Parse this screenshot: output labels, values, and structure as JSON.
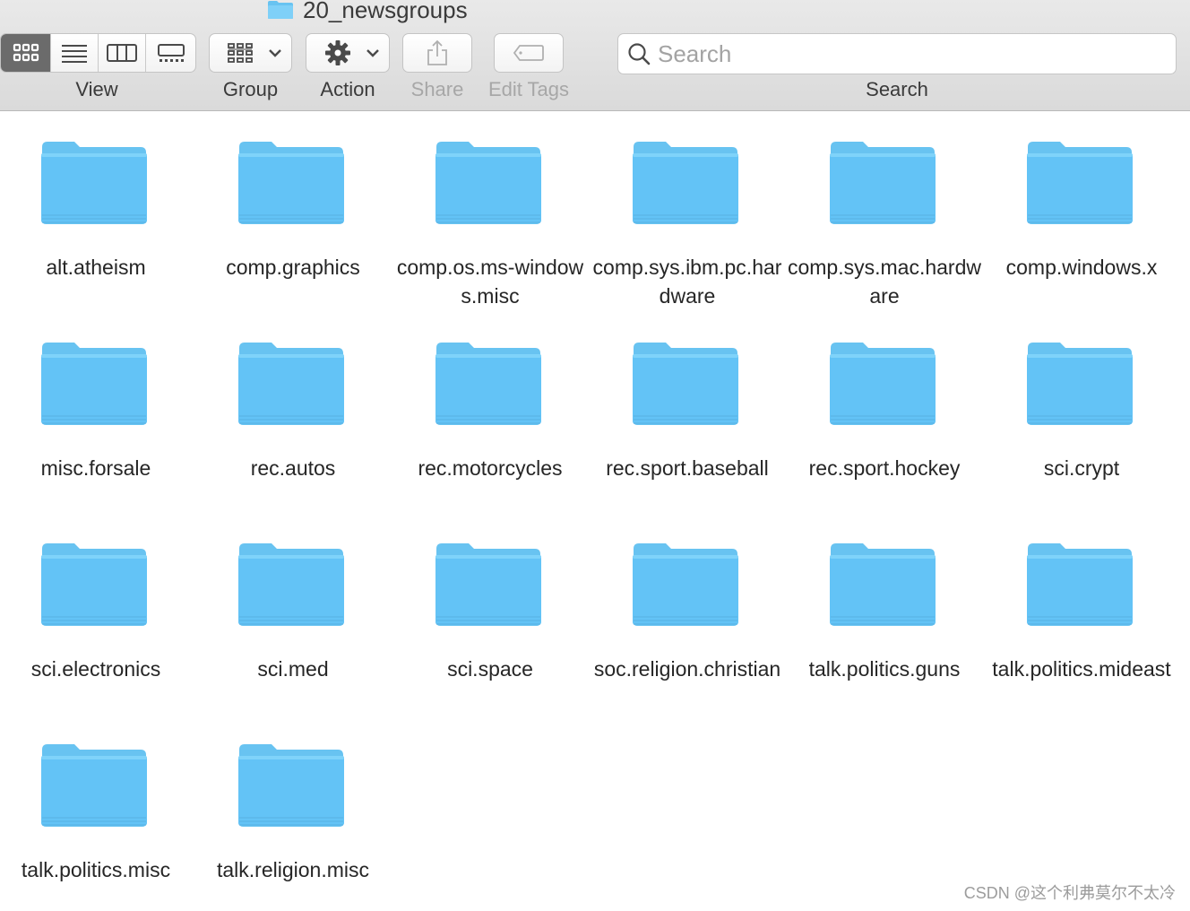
{
  "window": {
    "title": "20_newsgroups"
  },
  "toolbar": {
    "view_label": "View",
    "group_label": "Group",
    "action_label": "Action",
    "share_label": "Share",
    "edit_tags_label": "Edit Tags",
    "search_label": "Search",
    "search_placeholder": "Search",
    "view_modes": [
      "icon-view-icon",
      "list-view-icon",
      "column-view-icon",
      "gallery-view-icon"
    ],
    "active_view": "icon-view-icon"
  },
  "folders": [
    {
      "name": "alt.atheism"
    },
    {
      "name": "comp.graphics"
    },
    {
      "name": "comp.os.ms-windows.misc"
    },
    {
      "name": "comp.sys.ibm.pc.hardware"
    },
    {
      "name": "comp.sys.mac.hardware"
    },
    {
      "name": "comp.windows.x"
    },
    {
      "name": "misc.forsale"
    },
    {
      "name": "rec.autos"
    },
    {
      "name": "rec.motorcycles"
    },
    {
      "name": "rec.sport.baseball"
    },
    {
      "name": "rec.sport.hockey"
    },
    {
      "name": "sci.crypt"
    },
    {
      "name": "sci.electronics"
    },
    {
      "name": "sci.med"
    },
    {
      "name": "sci.space"
    },
    {
      "name": "soc.religion.christian"
    },
    {
      "name": "talk.politics.guns"
    },
    {
      "name": "talk.politics.mideast"
    },
    {
      "name": "talk.politics.misc"
    },
    {
      "name": "talk.religion.misc"
    }
  ],
  "watermark": "CSDN @这个利弗莫尔不太冷",
  "colors": {
    "folder_top": "#74cdf9",
    "folder_body": "#62c2f5",
    "folder_tab": "#68c3f1",
    "toolbar_bg": "#dcdcdc",
    "active_segment": "#6b6b6b"
  }
}
